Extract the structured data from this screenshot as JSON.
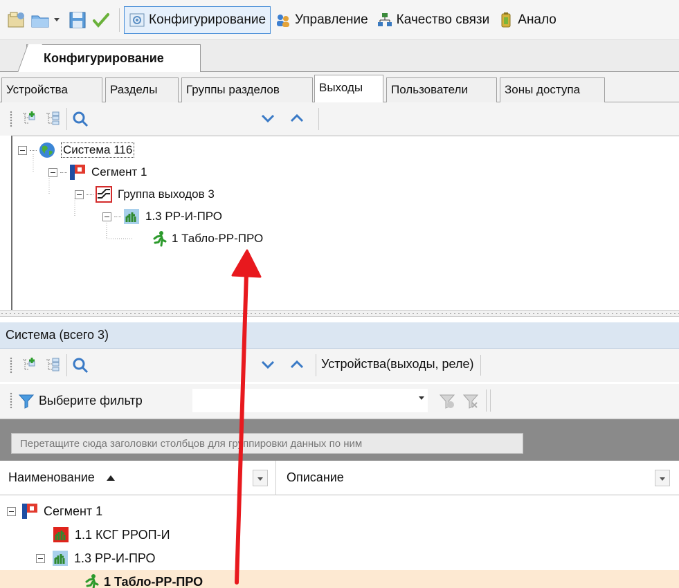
{
  "toolbar": {
    "buttons": [
      {
        "label": "Конфигурирование",
        "active": true
      },
      {
        "label": "Управление"
      },
      {
        "label": "Качество связи"
      },
      {
        "label": "Анало"
      }
    ]
  },
  "document_tab": {
    "label": "Конфигурирование"
  },
  "subtabs": [
    {
      "label": "Устройства"
    },
    {
      "label": "Разделы"
    },
    {
      "label": "Группы разделов"
    },
    {
      "label": "Выходы",
      "active": true
    },
    {
      "label": "Пользователи"
    },
    {
      "label": "Зоны доступа"
    }
  ],
  "tree": {
    "nodes": [
      {
        "label": "Система 116",
        "level": 0,
        "icon": "globe-icon"
      },
      {
        "label": "Сегмент 1",
        "level": 1,
        "icon": "segment-icon"
      },
      {
        "label": "Группа выходов 3",
        "level": 2,
        "icon": "output-group-icon"
      },
      {
        "label": "1.3 РР-И-ПРО",
        "level": 3,
        "icon": "device-icon"
      },
      {
        "label": "1 Табло-РР-ПРО",
        "level": 4,
        "icon": "exit-sign-icon"
      }
    ]
  },
  "lower_panel": {
    "title": "Система (всего 3)",
    "category": "Устройства(выходы, реле)",
    "filter_label": "Выберите фильтр",
    "group_hint": "Перетащите сюда заголовки столбцов для группировки данных по ним",
    "columns": [
      {
        "label": "Наименование"
      },
      {
        "label": "Описание"
      }
    ],
    "rows": [
      {
        "label": "Сегмент 1",
        "icon": "segment-icon"
      },
      {
        "label": "1.1 КСГ РРОП-И",
        "icon": "device-red-icon"
      },
      {
        "label": "1.3 РР-И-ПРО",
        "icon": "device-icon"
      },
      {
        "label": "1 Табло-РР-ПРО",
        "icon": "exit-sign-icon",
        "selected": true
      }
    ]
  },
  "colors": {
    "accent": "#4a8fd8",
    "selection": "#fde9d2",
    "annotation_arrow": "#e8191e",
    "panel_header": "#dbe6f2"
  }
}
